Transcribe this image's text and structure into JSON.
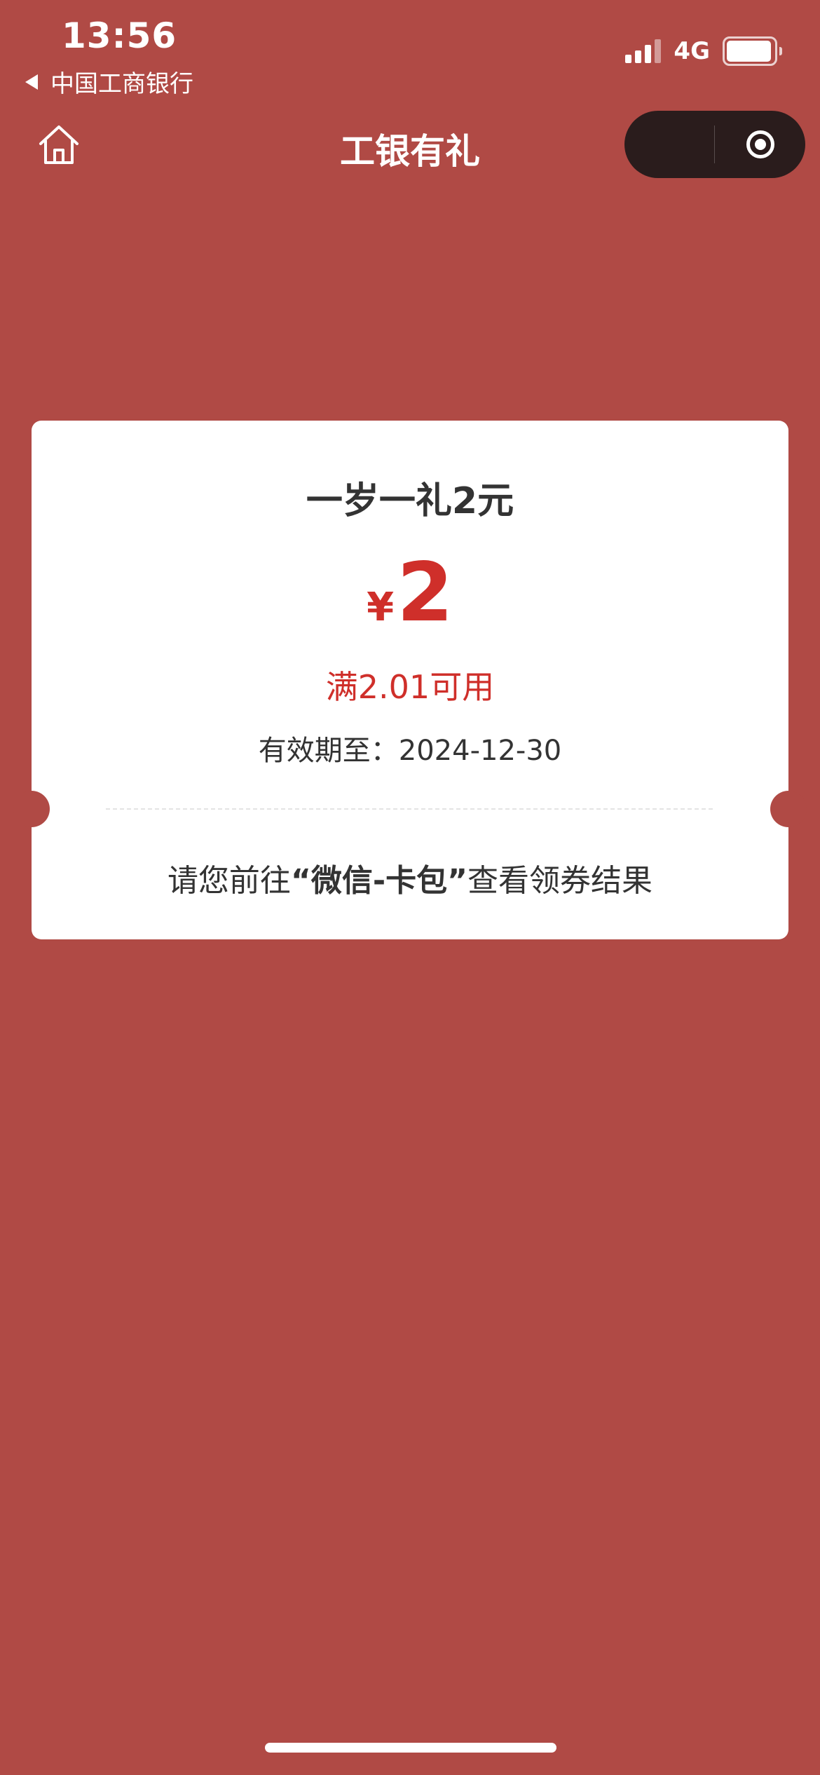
{
  "status_bar": {
    "time": "13:56",
    "back_app": "中国工商银行",
    "network": "4G",
    "battery_level": 0.95,
    "signal_bars": 3
  },
  "nav": {
    "title": "工银有礼",
    "home_icon": "home-icon",
    "close_icon": "miniprogram-close-icon"
  },
  "coupon": {
    "title": "一岁一礼2元",
    "currency": "¥",
    "amount": "2",
    "condition": "满2.01可用",
    "validity_label": "有效期至：",
    "validity_date": "2024-12-30",
    "notice_prefix": "请您前往",
    "notice_highlight": "“微信-卡包”",
    "notice_suffix": "查看领券结果"
  },
  "colors": {
    "background": "#b04a45",
    "accent_red": "#cf2f2a",
    "card": "#ffffff",
    "capsule": "#2a1c1c"
  }
}
